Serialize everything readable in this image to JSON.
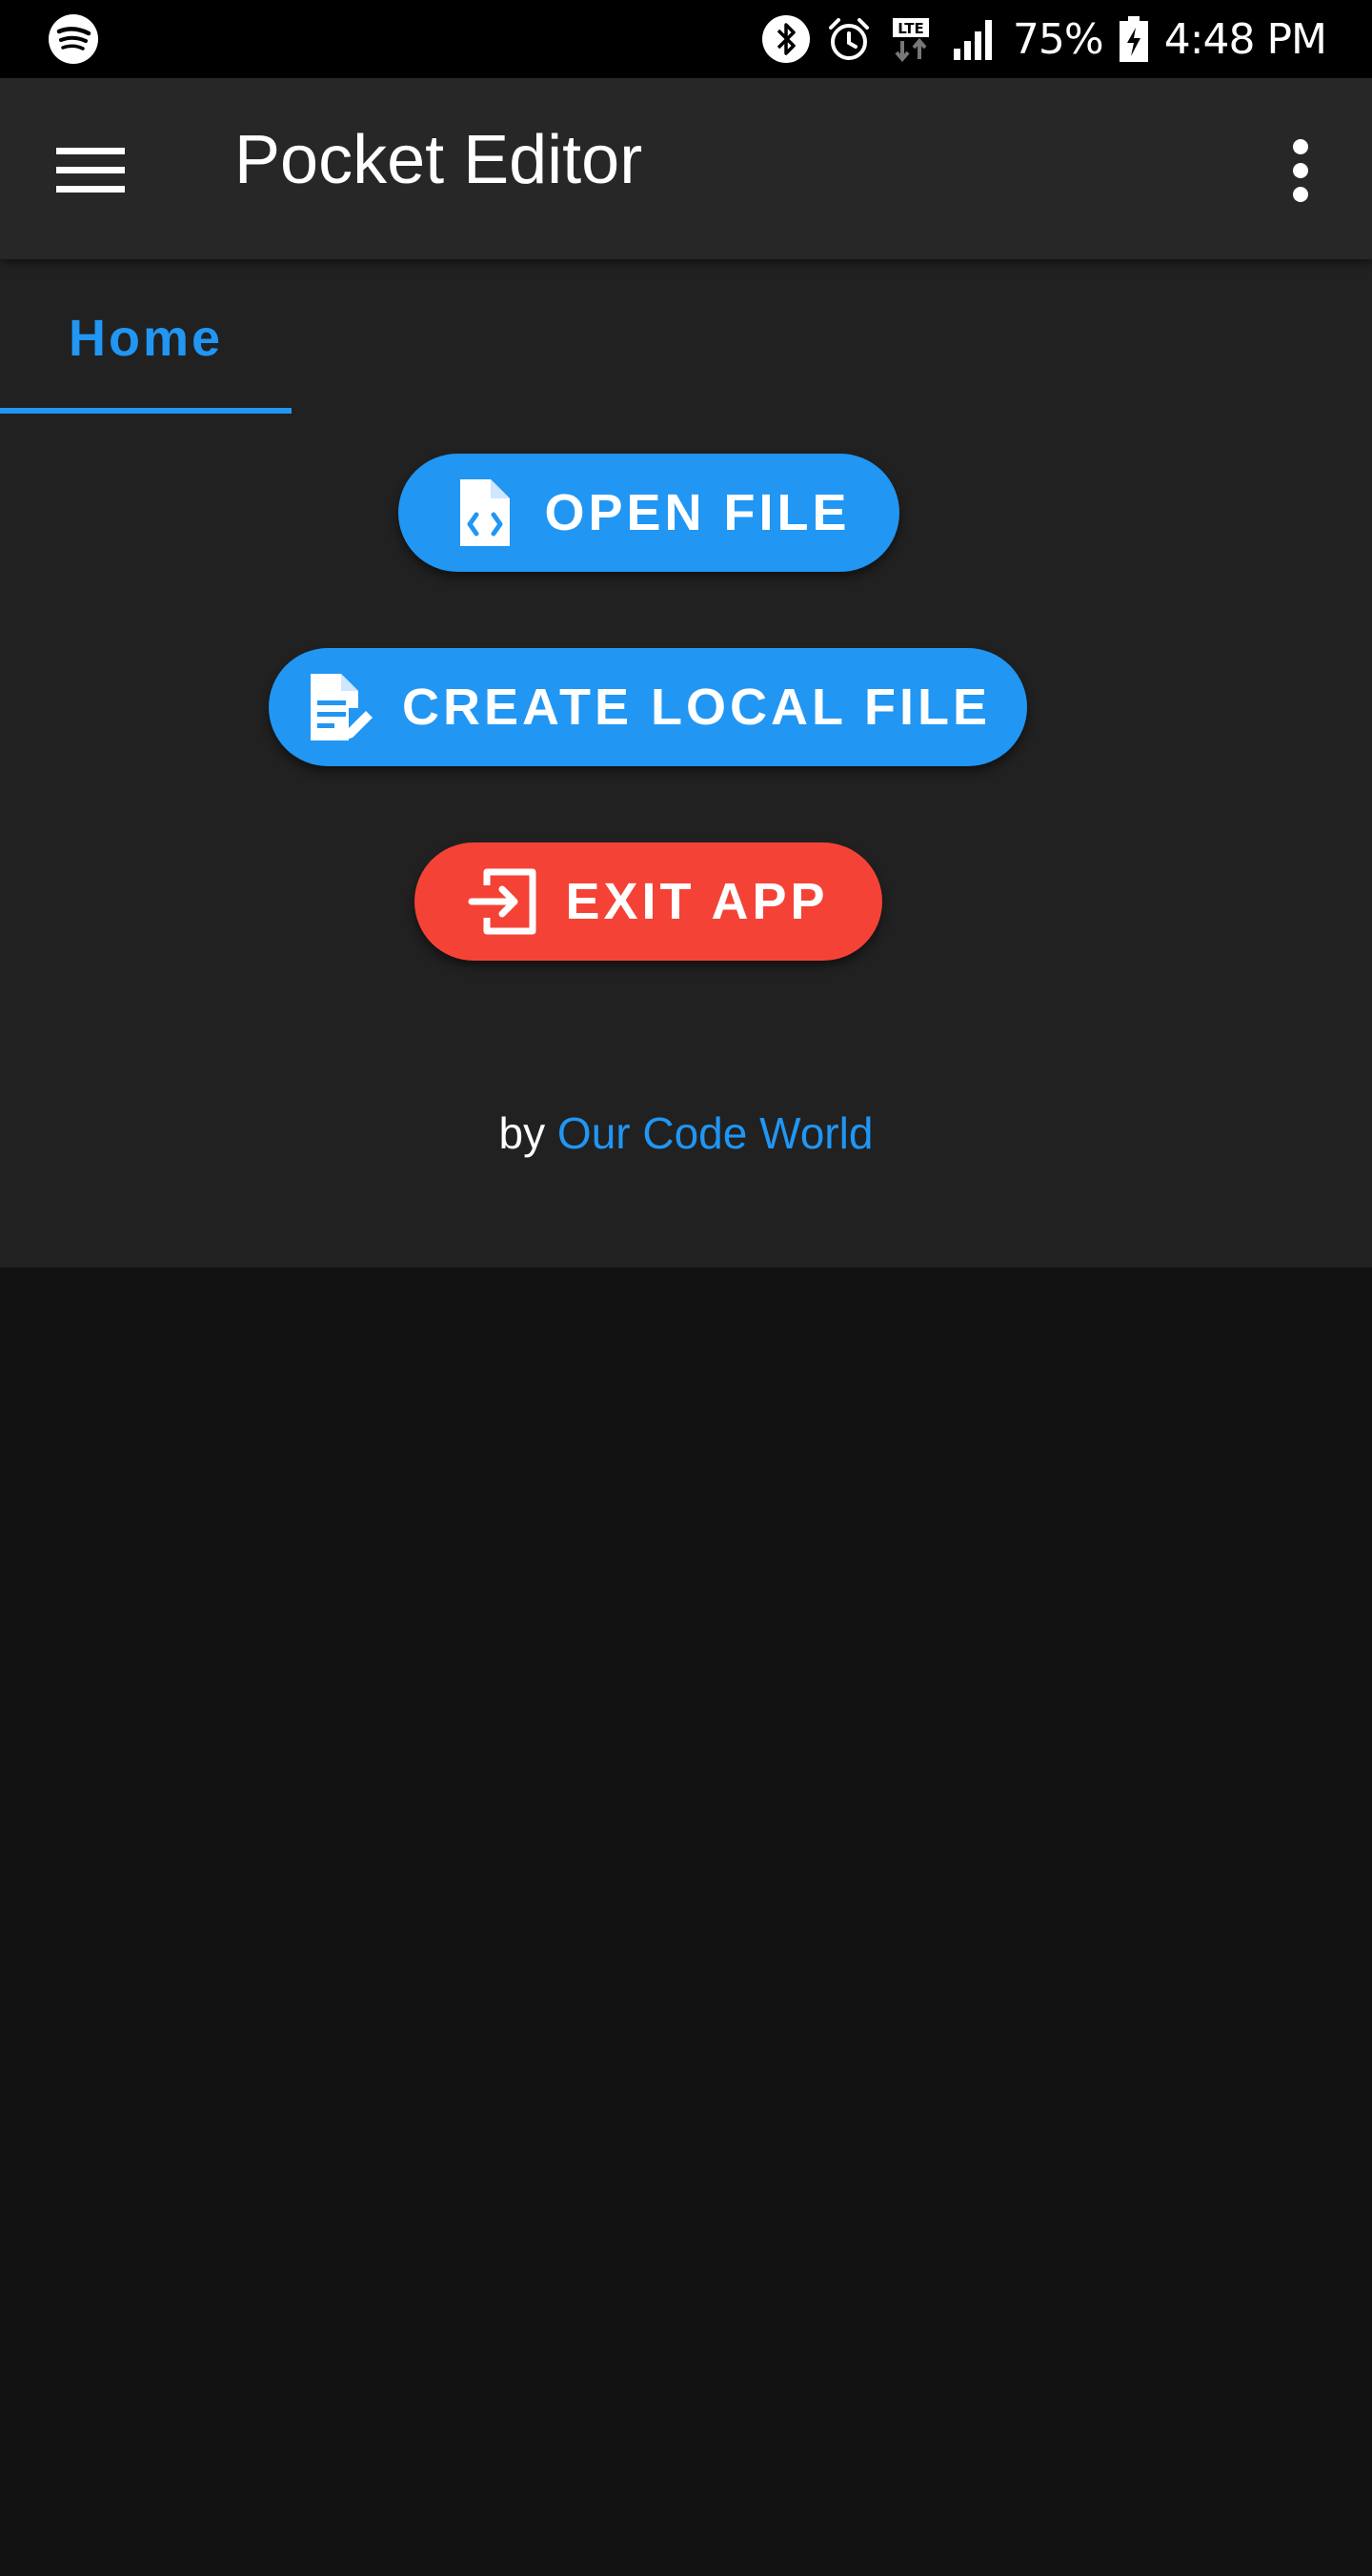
{
  "status_bar": {
    "battery_percent": "75%",
    "time": "4:48 PM",
    "icons": [
      "spotify-icon",
      "bluetooth-icon",
      "alarm-icon",
      "lte-icon",
      "signal-icon",
      "battery-charging-icon"
    ]
  },
  "app_bar": {
    "title": "Pocket Editor",
    "menu_icon": "menu-icon",
    "overflow_icon": "more-vert-icon"
  },
  "tabs": [
    {
      "label": "Home",
      "selected": true
    }
  ],
  "actions": {
    "open_file": {
      "label": "OPEN FILE",
      "icon": "file-code-icon",
      "color": "#2196f3"
    },
    "create_local_file": {
      "label": "CREATE LOCAL FILE",
      "icon": "file-edit-icon",
      "color": "#2196f3"
    },
    "exit_app": {
      "label": "EXIT APP",
      "icon": "exit-icon",
      "color": "#f44336"
    }
  },
  "credit": {
    "prefix": "by",
    "link_text": "Our Code World"
  },
  "colors": {
    "accent": "#2196f3",
    "danger": "#f44336",
    "app_bar": "#272727",
    "content": "#212121",
    "background": "#121212"
  }
}
